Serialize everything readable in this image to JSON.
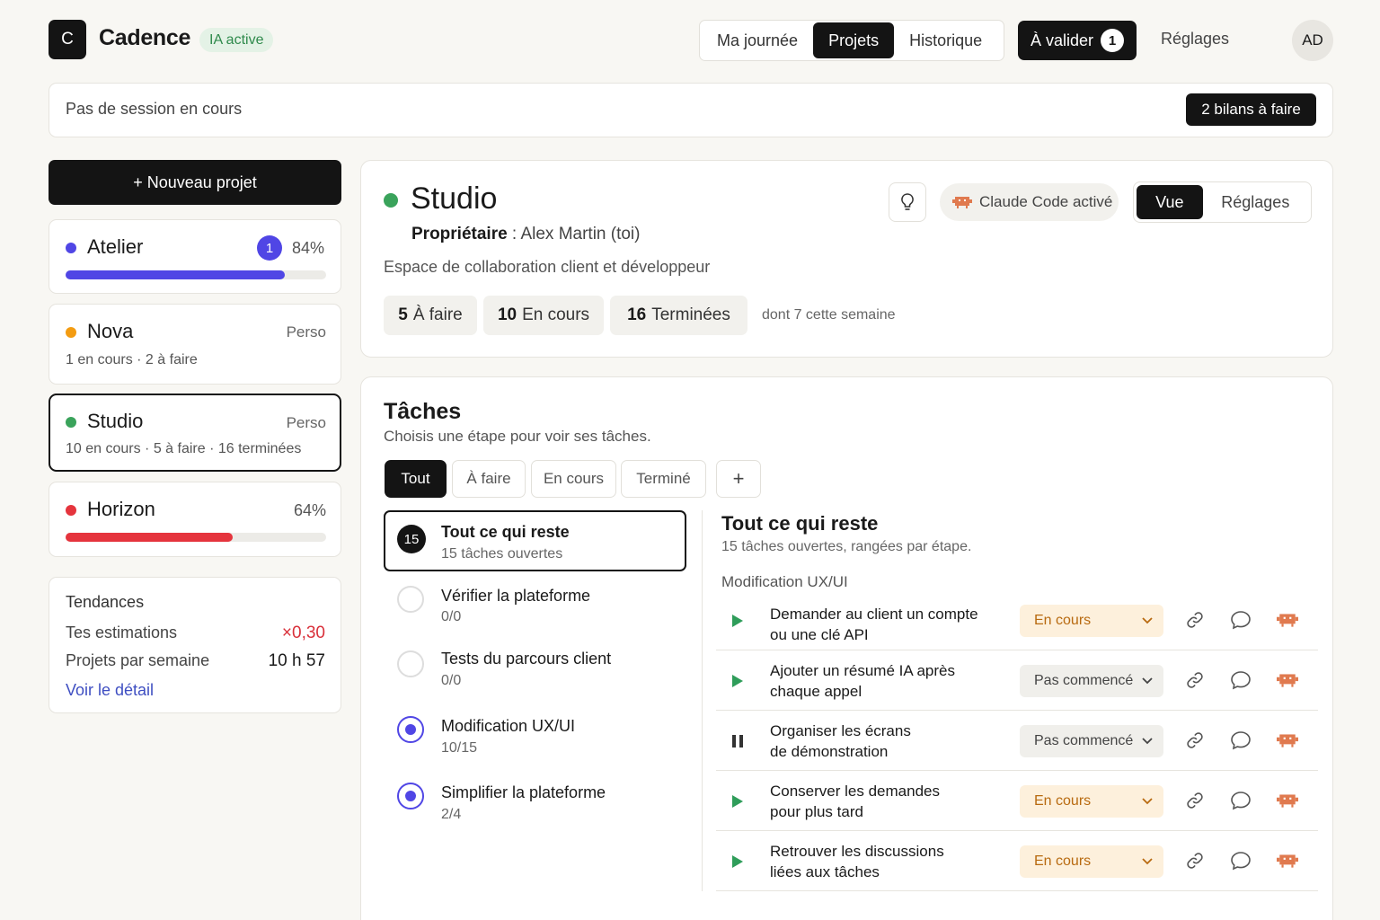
{
  "header": {
    "logo_letter": "C",
    "app_name": "Cadence",
    "ia_badge": "IA active",
    "nav": [
      "Ma journée",
      "Projets",
      "Historique"
    ],
    "valider_label": "À valider",
    "valider_count": "1",
    "settings_label": "Réglages",
    "avatar_initials": "AD"
  },
  "session": {
    "status": "Pas de session en cours",
    "bilans_button": "2 bilans à faire"
  },
  "sidebar": {
    "new_project": "+ Nouveau projet",
    "projects": [
      {
        "name": "Atelier",
        "color": "#5046e5",
        "badge": "1",
        "percent": "84%",
        "progress": 0.84
      },
      {
        "name": "Nova",
        "color": "#f39c12",
        "tag": "Perso",
        "subtitle": "1 en cours · 2 à faire"
      },
      {
        "name": "Studio",
        "color": "#3aa35b",
        "tag": "Perso",
        "subtitle": "10 en cours · 5 à faire · 16 terminées"
      },
      {
        "name": "Horizon",
        "color": "#e5343d",
        "percent": "64%",
        "progress": 0.64
      }
    ],
    "trends": {
      "title": "Tendances",
      "rows": [
        {
          "label": "Tes estimations",
          "value": "×0,30",
          "color": "#d9303a"
        },
        {
          "label": "Projets par semaine",
          "value": "10 h 57",
          "color": "#1a1a1a"
        }
      ],
      "link": "Voir le détail"
    }
  },
  "project": {
    "title": "Studio",
    "dot_color": "#3aa35b",
    "owner_label": "Propriétaire",
    "owner_sep": " : ",
    "owner_value": "Alex Martin (toi)",
    "description": "Espace de collaboration client et développeur",
    "claude_label": "Claude Code activé",
    "view_tabs": [
      "Vue",
      "Réglages"
    ],
    "stats": [
      {
        "num": "5",
        "label": "À faire"
      },
      {
        "num": "10",
        "label": "En cours"
      },
      {
        "num": "16",
        "label": "Terminées"
      }
    ],
    "stats_note": "dont 7 cette semaine"
  },
  "tasks": {
    "title": "Tâches",
    "subtitle": "Choisis une étape pour voir ses tâches.",
    "filters": [
      "Tout",
      "À faire",
      "En cours",
      "Terminé",
      "+"
    ],
    "stages": [
      {
        "badge": "15",
        "title": "Tout ce qui reste",
        "sub": "15 tâches ouvertes"
      },
      {
        "title": "Vérifier la plateforme",
        "sub": "0/0"
      },
      {
        "title": "Tests du parcours client",
        "sub": "0/0"
      },
      {
        "title": "Modification UX/UI",
        "sub": "10/15"
      },
      {
        "title": "Simplifier la plateforme",
        "sub": "2/4"
      }
    ],
    "detail_title": "Tout ce qui reste",
    "detail_subtitle": "15 tâches ouvertes, rangées par étape.",
    "group_label": "Modification UX/UI",
    "rows": [
      {
        "line1": "Demander au client un compte",
        "line2": "ou une clé API",
        "status": "En cours",
        "icon": "play-icon"
      },
      {
        "line1": "Ajouter un résumé IA après",
        "line2": "chaque appel",
        "status": "Pas commencé",
        "icon": "play-icon"
      },
      {
        "line1": "Organiser les écrans",
        "line2": "de démonstration",
        "status": "Pas commencé",
        "icon": "pause-icon"
      },
      {
        "line1": "Conserver les demandes",
        "line2": "pour plus tard",
        "status": "En cours",
        "icon": "play-icon"
      },
      {
        "line1": "Retrouver les discussions",
        "line2": "liées aux tâches",
        "status": "En cours",
        "icon": "play-icon"
      }
    ]
  }
}
